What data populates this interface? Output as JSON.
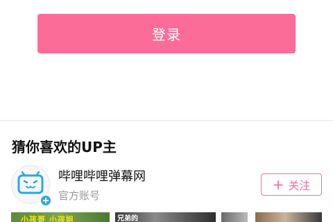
{
  "login": {
    "label": "登录"
  },
  "section": {
    "title": "猜你喜欢的UP主"
  },
  "up": {
    "name": "哔哩哔哩弹幕网",
    "subtitle": "官方账号",
    "avatar_icon": "bilibili-tv-icon",
    "badge_icon": "verified-plus-icon"
  },
  "follow": {
    "plus": "+",
    "label": "关注"
  },
  "thumbnails": [
    {
      "caption": "小孩哥 小孩姐"
    },
    {
      "caption": "兄弟的"
    },
    {
      "caption": ""
    },
    {
      "caption": ""
    }
  ],
  "colors": {
    "accent": "#fb6c98",
    "badge": "#2aa7e0",
    "subtext": "#999999"
  }
}
